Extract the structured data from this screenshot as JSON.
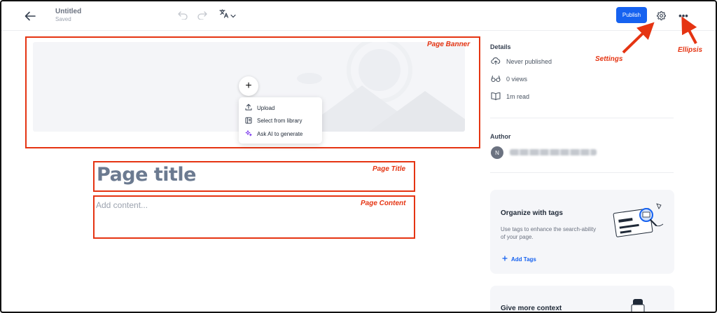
{
  "header": {
    "doc_title": "Untitled",
    "doc_status": "Saved",
    "publish_label": "Publish",
    "ellipsis_label": "•••",
    "icons": [
      "back-arrow-icon",
      "undo-icon",
      "redo-icon",
      "translate-icon",
      "chevron-down-icon",
      "gear-icon",
      "ellipsis-icon"
    ]
  },
  "banner": {
    "add_label": "+",
    "menu": [
      {
        "label": "Upload",
        "icon": "upload-icon"
      },
      {
        "label": "Select from library",
        "icon": "library-icon"
      },
      {
        "label": "Ask AI to generate",
        "icon": "sparkle-icon"
      }
    ]
  },
  "editor": {
    "title_placeholder": "Page title",
    "content_placeholder": "Add content..."
  },
  "annotations": {
    "banner": "Page Banner",
    "title": "Page Title",
    "content": "Page Content",
    "settings": "Settings",
    "ellipsis": "Ellipsis",
    "color": "#e53412"
  },
  "sidebar": {
    "details_title": "Details",
    "details": [
      {
        "text": "Never published",
        "icon": "cloud-upload-icon"
      },
      {
        "text": "0 views",
        "icon": "glasses-icon"
      },
      {
        "text": "1m read",
        "icon": "book-icon"
      }
    ],
    "author_title": "Author",
    "author_initial": "N",
    "tags_card": {
      "title": "Organize with tags",
      "description": "Use tags to enhance the search-ability of your page.",
      "add_label": "Add Tags"
    },
    "context_card": {
      "title": "Give more context"
    }
  },
  "colors": {
    "accent": "#1662f0",
    "annotation": "#e53412",
    "title_text": "#6b7a90"
  }
}
